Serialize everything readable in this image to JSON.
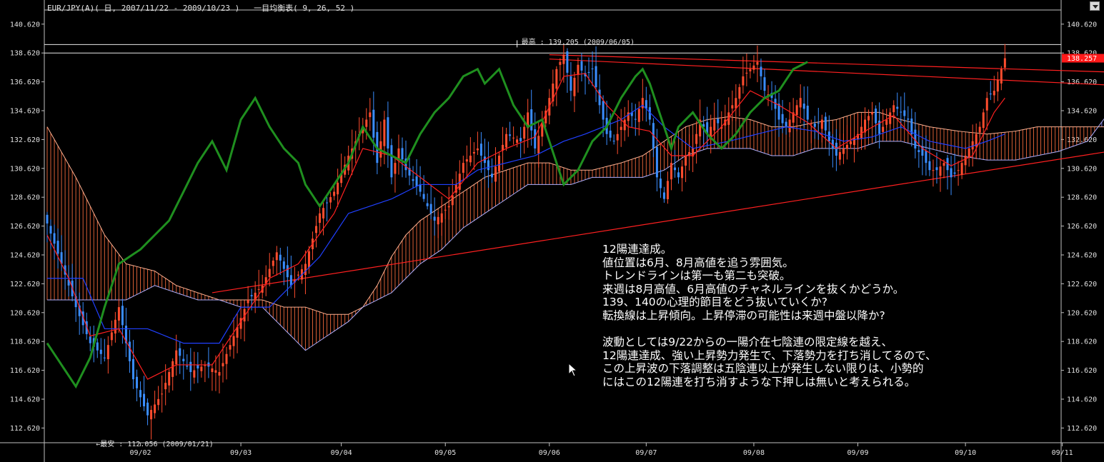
{
  "header": {
    "title": "EUR/JPY(A)( 日, 2007/11/22 - 2009/10/23 )   一目均衡表( 9, 26, 52 )"
  },
  "colors": {
    "background": "#000000",
    "up_candle": "#ff4d2e",
    "down_candle": "#3a8dff",
    "tenkan": "#ff2020",
    "kijun": "#2040ff",
    "chikou": "#1f8f1f",
    "cloud_bull_hatch": "#ff7040",
    "cloud_bear_hatch": "#8a8aff",
    "trendline": "#ff2020",
    "price_box": "#ff1a1a"
  },
  "annotations": {
    "high": "最高 : 139.205 (2009/06/05)",
    "low": "←最安 : 112.056 (2009/01/21)",
    "current_price": "138.257"
  },
  "notes": {
    "lines": [
      "12陽連達成。",
      "値位置は6月、8月高値を追う雰囲気。",
      "トレンドラインは第一も第二も突破。",
      "来週は8月高値、6月高値のチャネルラインを抜くかどうか。",
      "139、140の心理的節目をどう抜いていくか?",
      "転換線は上昇傾向。上昇停滞の可能性は来週中盤以降か?",
      "",
      "波動としては9/22からの一陽介在七陰連の限定線を越え、",
      "12陽連達成、強い上昇勢力発生で、下落勢力を打ち消してるので、",
      "この上昇波の下落調整は五陰連以上が発生しない限りは、小勢的",
      "にはこの12陽連を打ち消すような下押しは無いと考えられる。"
    ]
  },
  "chart_data": {
    "type": "candlestick",
    "title": "EUR/JPY(A)( 日, 2007/11/22 - 2009/10/23 )",
    "indicator": "一目均衡表( 9, 26, 52 )",
    "ylim": [
      111.6,
      141.6
    ],
    "y_ticks": [
      140.62,
      138.62,
      136.62,
      134.62,
      132.62,
      130.62,
      128.62,
      126.62,
      124.62,
      122.62,
      120.62,
      118.62,
      116.62,
      114.62,
      112.62
    ],
    "x_ticks": [
      "09/02",
      "09/03",
      "09/04",
      "09/05",
      "09/06",
      "09/07",
      "09/08",
      "09/09",
      "09/10",
      "09/11"
    ],
    "x_tick_index": [
      26,
      54,
      82,
      111,
      140,
      167,
      197,
      226,
      256,
      283
    ],
    "n_bars": 268,
    "cloud_extends_to_index": 296,
    "extremes": {
      "high": 139.205,
      "high_date": "2009/06/05",
      "low": 112.056,
      "low_date": "2009/01/21",
      "last": 138.257
    },
    "price_anchors": [
      [
        0,
        126.8
      ],
      [
        4,
        124.0
      ],
      [
        8,
        121.0
      ],
      [
        12,
        118.5
      ],
      [
        16,
        117.5
      ],
      [
        20,
        121.0
      ],
      [
        24,
        116.0
      ],
      [
        28,
        113.5
      ],
      [
        32,
        115.0
      ],
      [
        36,
        118.0
      ],
      [
        40,
        116.5
      ],
      [
        44,
        117.0
      ],
      [
        48,
        116.5
      ],
      [
        52,
        119.0
      ],
      [
        56,
        121.5
      ],
      [
        60,
        122.5
      ],
      [
        64,
        124.8
      ],
      [
        68,
        122.5
      ],
      [
        72,
        124.0
      ],
      [
        76,
        127.5
      ],
      [
        80,
        129.0
      ],
      [
        84,
        131.5
      ],
      [
        88,
        133.5
      ],
      [
        90,
        134.5
      ],
      [
        92,
        131.0
      ],
      [
        94,
        134.0
      ],
      [
        96,
        130.0
      ],
      [
        98,
        132.0
      ],
      [
        100,
        130.5
      ],
      [
        104,
        129.0
      ],
      [
        108,
        127.0
      ],
      [
        112,
        128.0
      ],
      [
        116,
        131.0
      ],
      [
        120,
        132.0
      ],
      [
        124,
        130.0
      ],
      [
        128,
        133.0
      ],
      [
        132,
        132.5
      ],
      [
        134,
        134.5
      ],
      [
        136,
        132.0
      ],
      [
        140,
        135.5
      ],
      [
        142,
        137.5
      ],
      [
        144,
        138.5
      ],
      [
        146,
        136.0
      ],
      [
        148,
        137.8
      ],
      [
        150,
        137.0
      ],
      [
        152,
        137.5
      ],
      [
        154,
        135.0
      ],
      [
        156,
        133.0
      ],
      [
        158,
        132.5
      ],
      [
        160,
        133.5
      ],
      [
        162,
        134.5
      ],
      [
        164,
        134.0
      ],
      [
        166,
        135.5
      ],
      [
        168,
        134.0
      ],
      [
        170,
        130.0
      ],
      [
        172,
        128.5
      ],
      [
        174,
        131.0
      ],
      [
        176,
        130.0
      ],
      [
        178,
        131.5
      ],
      [
        180,
        132.0
      ],
      [
        182,
        134.0
      ],
      [
        184,
        133.0
      ],
      [
        186,
        134.0
      ],
      [
        188,
        133.5
      ],
      [
        190,
        134.5
      ],
      [
        192,
        135.5
      ],
      [
        194,
        137.0
      ],
      [
        196,
        137.5
      ],
      [
        198,
        138.0
      ],
      [
        200,
        136.0
      ],
      [
        202,
        135.5
      ],
      [
        204,
        134.0
      ],
      [
        206,
        133.5
      ],
      [
        208,
        134.5
      ],
      [
        210,
        135.5
      ],
      [
        212,
        134.0
      ],
      [
        214,
        133.5
      ],
      [
        216,
        134.0
      ],
      [
        218,
        132.5
      ],
      [
        220,
        131.5
      ],
      [
        222,
        132.0
      ],
      [
        224,
        132.5
      ],
      [
        226,
        133.0
      ],
      [
        228,
        134.0
      ],
      [
        230,
        134.5
      ],
      [
        232,
        133.0
      ],
      [
        234,
        134.0
      ],
      [
        236,
        135.0
      ],
      [
        238,
        134.5
      ],
      [
        240,
        134.0
      ],
      [
        242,
        132.0
      ],
      [
        244,
        131.5
      ],
      [
        246,
        130.5
      ],
      [
        248,
        130.5
      ],
      [
        250,
        131.0
      ],
      [
        252,
        130.0
      ],
      [
        254,
        130.5
      ],
      [
        256,
        131.5
      ],
      [
        258,
        132.5
      ],
      [
        260,
        133.5
      ],
      [
        262,
        135.5
      ],
      [
        264,
        136.0
      ],
      [
        266,
        137.5
      ],
      [
        267,
        138.257
      ]
    ],
    "tenkan_anchors": [
      [
        0,
        126.0
      ],
      [
        6,
        123.0
      ],
      [
        12,
        119.0
      ],
      [
        20,
        119.5
      ],
      [
        28,
        116.0
      ],
      [
        36,
        117.0
      ],
      [
        46,
        117.0
      ],
      [
        54,
        120.0
      ],
      [
        62,
        123.0
      ],
      [
        70,
        124.0
      ],
      [
        80,
        127.5
      ],
      [
        88,
        132.0
      ],
      [
        96,
        131.5
      ],
      [
        104,
        130.0
      ],
      [
        112,
        128.5
      ],
      [
        120,
        131.0
      ],
      [
        128,
        132.0
      ],
      [
        136,
        132.8
      ],
      [
        144,
        137.0
      ],
      [
        150,
        137.2
      ],
      [
        156,
        135.0
      ],
      [
        162,
        133.5
      ],
      [
        168,
        133.2
      ],
      [
        174,
        131.5
      ],
      [
        180,
        131.5
      ],
      [
        188,
        133.5
      ],
      [
        196,
        136.0
      ],
      [
        204,
        135.0
      ],
      [
        212,
        133.8
      ],
      [
        220,
        132.0
      ],
      [
        228,
        133.2
      ],
      [
        236,
        134.3
      ],
      [
        244,
        132.0
      ],
      [
        252,
        130.8
      ],
      [
        258,
        131.5
      ],
      [
        264,
        134.5
      ],
      [
        267,
        135.5
      ]
    ],
    "kijun_anchors": [
      [
        0,
        123.0
      ],
      [
        10,
        123.0
      ],
      [
        16,
        119.5
      ],
      [
        28,
        119.5
      ],
      [
        38,
        118.5
      ],
      [
        48,
        118.5
      ],
      [
        54,
        121.0
      ],
      [
        62,
        121.0
      ],
      [
        68,
        122.5
      ],
      [
        76,
        124.5
      ],
      [
        84,
        127.5
      ],
      [
        96,
        128.5
      ],
      [
        104,
        129.5
      ],
      [
        114,
        129.5
      ],
      [
        120,
        130.5
      ],
      [
        128,
        131.0
      ],
      [
        136,
        131.5
      ],
      [
        144,
        132.5
      ],
      [
        150,
        133.0
      ],
      [
        160,
        134.0
      ],
      [
        166,
        135.0
      ],
      [
        172,
        133.5
      ],
      [
        180,
        132.0
      ],
      [
        190,
        132.5
      ],
      [
        198,
        133.0
      ],
      [
        206,
        133.5
      ],
      [
        214,
        133.2
      ],
      [
        222,
        132.5
      ],
      [
        230,
        132.8
      ],
      [
        238,
        133.5
      ],
      [
        246,
        132.5
      ],
      [
        256,
        132.0
      ],
      [
        262,
        132.5
      ],
      [
        267,
        133.0
      ]
    ],
    "chikou_anchors": [
      [
        0,
        118.5
      ],
      [
        4,
        117.0
      ],
      [
        8,
        115.5
      ],
      [
        12,
        117.5
      ],
      [
        16,
        121.0
      ],
      [
        20,
        124.0
      ],
      [
        26,
        125.0
      ],
      [
        30,
        126.0
      ],
      [
        34,
        127.0
      ],
      [
        38,
        129.0
      ],
      [
        42,
        131.0
      ],
      [
        46,
        132.5
      ],
      [
        50,
        130.5
      ],
      [
        54,
        134.0
      ],
      [
        58,
        135.5
      ],
      [
        62,
        133.5
      ],
      [
        66,
        132.0
      ],
      [
        70,
        131.0
      ],
      [
        72,
        129.5
      ],
      [
        76,
        128.0
      ],
      [
        80,
        129.5
      ],
      [
        84,
        131.0
      ],
      [
        88,
        133.5
      ],
      [
        92,
        132.0
      ],
      [
        96,
        131.5
      ],
      [
        100,
        131.0
      ],
      [
        104,
        133.0
      ],
      [
        108,
        134.5
      ],
      [
        112,
        135.5
      ],
      [
        116,
        137.0
      ],
      [
        120,
        137.5
      ],
      [
        122,
        136.5
      ],
      [
        126,
        137.5
      ],
      [
        130,
        135.0
      ],
      [
        134,
        133.5
      ],
      [
        138,
        134.0
      ],
      [
        140,
        132.5
      ],
      [
        142,
        131.0
      ],
      [
        144,
        129.5
      ],
      [
        148,
        130.5
      ],
      [
        152,
        132.5
      ],
      [
        156,
        133.5
      ],
      [
        160,
        135.5
      ],
      [
        164,
        137.0
      ],
      [
        166,
        137.5
      ],
      [
        168,
        136.5
      ],
      [
        170,
        135.0
      ],
      [
        172,
        133.5
      ],
      [
        174,
        132.0
      ],
      [
        176,
        133.5
      ],
      [
        180,
        134.5
      ],
      [
        184,
        133.0
      ],
      [
        186,
        132.5
      ],
      [
        188,
        132.0
      ],
      [
        192,
        133.0
      ],
      [
        196,
        134.5
      ],
      [
        200,
        135.5
      ],
      [
        204,
        136.0
      ],
      [
        208,
        137.5
      ],
      [
        212,
        138.0
      ]
    ],
    "spanA_anchors": [
      [
        0,
        133.5
      ],
      [
        8,
        130.0
      ],
      [
        16,
        126.0
      ],
      [
        22,
        124.0
      ],
      [
        30,
        123.5
      ],
      [
        36,
        122.5
      ],
      [
        42,
        122.0
      ],
      [
        48,
        121.5
      ],
      [
        54,
        121.5
      ],
      [
        60,
        121.5
      ],
      [
        66,
        121.0
      ],
      [
        72,
        121.0
      ],
      [
        78,
        120.5
      ],
      [
        84,
        120.5
      ],
      [
        88,
        121.0
      ],
      [
        92,
        122.5
      ],
      [
        96,
        124.5
      ],
      [
        100,
        126.0
      ],
      [
        104,
        127.0
      ],
      [
        110,
        128.0
      ],
      [
        116,
        129.0
      ],
      [
        122,
        130.0
      ],
      [
        128,
        130.5
      ],
      [
        134,
        131.0
      ],
      [
        140,
        131.0
      ],
      [
        146,
        130.5
      ],
      [
        152,
        130.5
      ],
      [
        160,
        131.0
      ],
      [
        166,
        131.5
      ],
      [
        172,
        132.5
      ],
      [
        178,
        133.5
      ],
      [
        184,
        134.0
      ],
      [
        190,
        134.2
      ],
      [
        196,
        134.0
      ],
      [
        202,
        133.5
      ],
      [
        208,
        133.5
      ],
      [
        214,
        133.8
      ],
      [
        220,
        134.0
      ],
      [
        226,
        134.5
      ],
      [
        232,
        134.5
      ],
      [
        238,
        134.0
      ],
      [
        246,
        133.5
      ],
      [
        254,
        133.2
      ],
      [
        262,
        133.0
      ],
      [
        270,
        133.2
      ],
      [
        276,
        133.5
      ],
      [
        282,
        133.5
      ],
      [
        290,
        133.5
      ],
      [
        296,
        133.5
      ]
    ],
    "spanB_anchors": [
      [
        0,
        121.5
      ],
      [
        8,
        121.5
      ],
      [
        16,
        121.5
      ],
      [
        22,
        121.5
      ],
      [
        30,
        122.5
      ],
      [
        36,
        122.0
      ],
      [
        42,
        121.5
      ],
      [
        48,
        121.5
      ],
      [
        54,
        121.0
      ],
      [
        60,
        121.0
      ],
      [
        66,
        119.5
      ],
      [
        72,
        118.0
      ],
      [
        78,
        119.0
      ],
      [
        84,
        120.0
      ],
      [
        88,
        121.0
      ],
      [
        92,
        121.5
      ],
      [
        96,
        122.0
      ],
      [
        100,
        123.0
      ],
      [
        104,
        124.0
      ],
      [
        110,
        125.0
      ],
      [
        116,
        126.5
      ],
      [
        122,
        127.5
      ],
      [
        128,
        128.5
      ],
      [
        134,
        129.5
      ],
      [
        140,
        129.5
      ],
      [
        146,
        129.5
      ],
      [
        152,
        130.0
      ],
      [
        160,
        130.0
      ],
      [
        166,
        130.0
      ],
      [
        172,
        130.5
      ],
      [
        178,
        131.5
      ],
      [
        184,
        132.0
      ],
      [
        190,
        132.0
      ],
      [
        196,
        132.0
      ],
      [
        202,
        131.5
      ],
      [
        208,
        131.5
      ],
      [
        214,
        132.0
      ],
      [
        220,
        132.0
      ],
      [
        226,
        132.0
      ],
      [
        232,
        132.5
      ],
      [
        238,
        132.5
      ],
      [
        246,
        132.0
      ],
      [
        254,
        131.5
      ],
      [
        262,
        131.2
      ],
      [
        270,
        131.2
      ],
      [
        276,
        131.5
      ],
      [
        282,
        131.8
      ],
      [
        290,
        132.5
      ],
      [
        296,
        134.5
      ]
    ],
    "trendlines": [
      {
        "from": [
          46,
          122.0
        ],
        "to": [
          296,
          131.8
        ]
      },
      {
        "from": [
          140,
          138.2
        ],
        "to": [
          296,
          136.4
        ]
      },
      {
        "from": [
          140,
          138.5
        ],
        "to": [
          296,
          137.3
        ]
      }
    ],
    "hlines": [
      139.205,
      138.62
    ]
  }
}
